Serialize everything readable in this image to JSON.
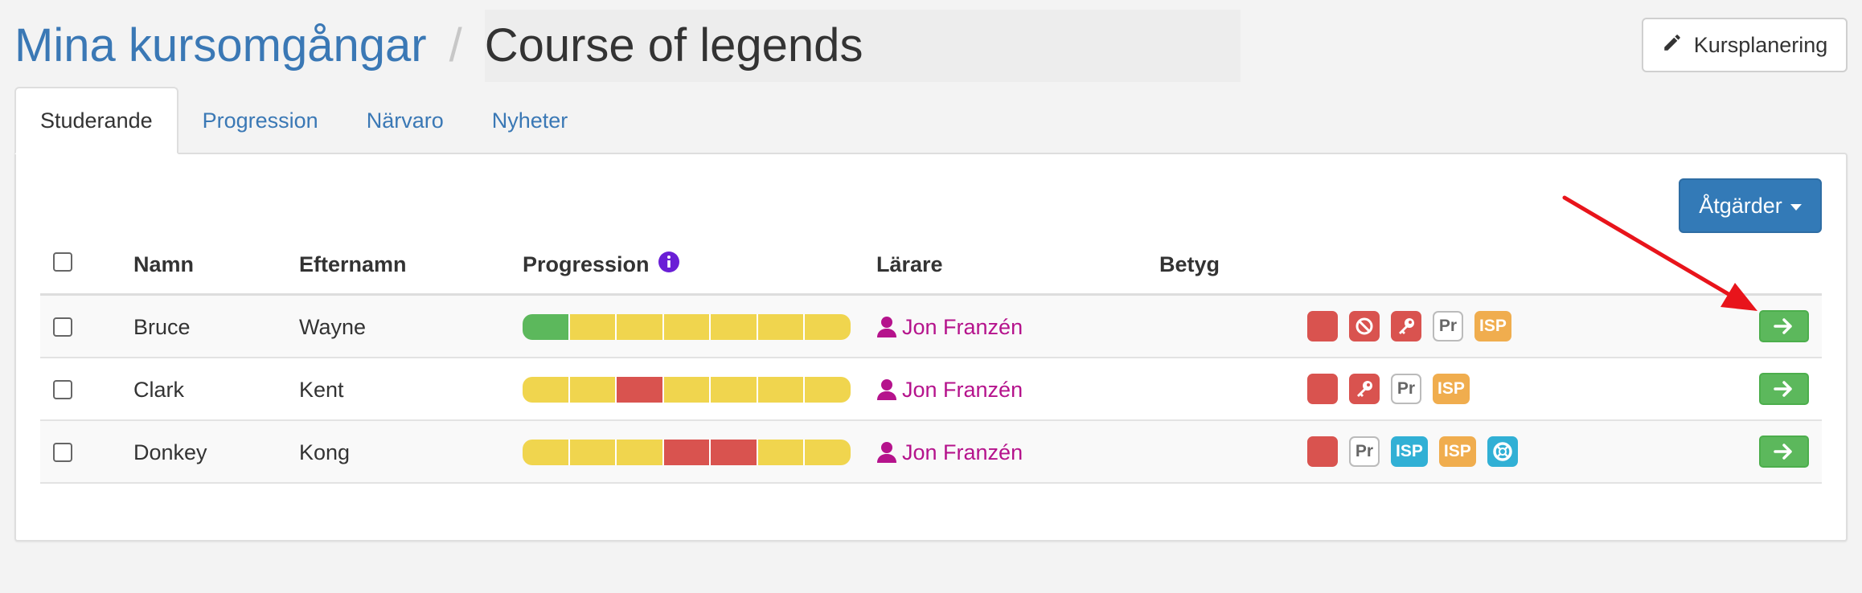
{
  "breadcrumb": {
    "parent": "Mina kursomgångar",
    "separator": "/",
    "current": "Course of legends"
  },
  "header_button": {
    "label": "Kursplanering",
    "icon": "pencil-icon"
  },
  "tabs": [
    {
      "label": "Studerande",
      "active": true
    },
    {
      "label": "Progression",
      "active": false
    },
    {
      "label": "Närvaro",
      "active": false
    },
    {
      "label": "Nyheter",
      "active": false
    }
  ],
  "actions_button": {
    "label": "Åtgärder"
  },
  "table": {
    "columns": {
      "name": "Namn",
      "surname": "Efternamn",
      "progression": "Progression",
      "teacher": "Lärare",
      "grade": "Betyg"
    },
    "rows": [
      {
        "first": "Bruce",
        "last": "Wayne",
        "teacher": "Jon Franzén",
        "grade": "",
        "progress": [
          "green",
          "yellow",
          "yellow",
          "yellow",
          "yellow",
          "yellow",
          "yellow"
        ],
        "badges": [
          {
            "type": "red",
            "label": ""
          },
          {
            "type": "red-ban",
            "label": ""
          },
          {
            "type": "red-key",
            "label": ""
          },
          {
            "type": "pr",
            "label": "Pr"
          },
          {
            "type": "isp-orange",
            "label": "ISP"
          }
        ]
      },
      {
        "first": "Clark",
        "last": "Kent",
        "teacher": "Jon Franzén",
        "grade": "",
        "progress": [
          "yellow",
          "yellow",
          "red",
          "yellow",
          "yellow",
          "yellow",
          "yellow"
        ],
        "badges": [
          {
            "type": "red",
            "label": ""
          },
          {
            "type": "red-key",
            "label": ""
          },
          {
            "type": "pr",
            "label": "Pr"
          },
          {
            "type": "isp-orange",
            "label": "ISP"
          }
        ]
      },
      {
        "first": "Donkey",
        "last": "Kong",
        "teacher": "Jon Franzén",
        "grade": "",
        "progress": [
          "yellow",
          "yellow",
          "yellow",
          "red",
          "red",
          "yellow",
          "yellow"
        ],
        "badges": [
          {
            "type": "red",
            "label": ""
          },
          {
            "type": "pr",
            "label": "Pr"
          },
          {
            "type": "isp-blue",
            "label": "ISP"
          },
          {
            "type": "isp-orange",
            "label": "ISP"
          },
          {
            "type": "lifebuoy",
            "label": ""
          }
        ]
      }
    ]
  },
  "colors": {
    "link": "#3a78b5",
    "teacher": "#b5138c",
    "primary": "#337ab7",
    "success": "#5cb85c",
    "danger": "#d9534f",
    "warning": "#f0ad4e",
    "info": "#31b0d5",
    "progress_green": "#5cb85c",
    "progress_yellow": "#f0d54e",
    "progress_red": "#d9534f",
    "info_icon": "#6a1fd6",
    "annotation_arrow": "#e8141b"
  }
}
